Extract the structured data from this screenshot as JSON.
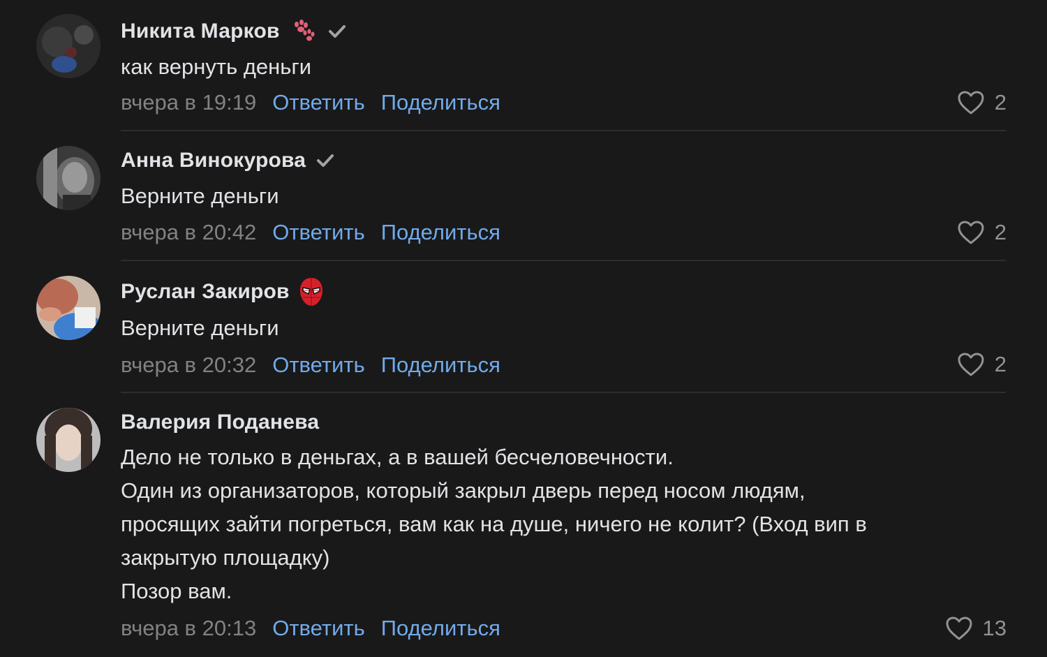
{
  "colors": {
    "background": "#191919",
    "text": "#e1e3e6",
    "secondary": "#828282",
    "link": "#71aaeb",
    "divider": "#2c2d2e"
  },
  "comments": [
    {
      "author": "Никита Марков",
      "emoji": "paw-prints-icon",
      "verified": true,
      "text": [
        "как вернуть деньги"
      ],
      "date": "вчера в 19:19",
      "reply_label": "Ответить",
      "share_label": "Поделиться",
      "likes": "2"
    },
    {
      "author": "Анна Винокурова",
      "verified": true,
      "text": [
        "Верните деньги"
      ],
      "date": "вчера в 20:42",
      "reply_label": "Ответить",
      "share_label": "Поделиться",
      "likes": "2"
    },
    {
      "author": "Руслан Закиров",
      "emoji": "spider-mask-icon",
      "verified": false,
      "text": [
        "Верните деньги"
      ],
      "date": "вчера в 20:32",
      "reply_label": "Ответить",
      "share_label": "Поделиться",
      "likes": "2"
    },
    {
      "author": "Валерия Поданева",
      "verified": false,
      "text": [
        "Дело не только в деньгах, а в вашей бесчеловечности.",
        "Один из организаторов, который закрыл дверь перед носом людям,",
        "просящих зайти погреться, вам как на душе, ничего не колит? (Вход вип в",
        "закрытую площадку)",
        "Позор вам."
      ],
      "date": "вчера в 20:13",
      "reply_label": "Ответить",
      "share_label": "Поделиться",
      "likes": "13"
    }
  ]
}
